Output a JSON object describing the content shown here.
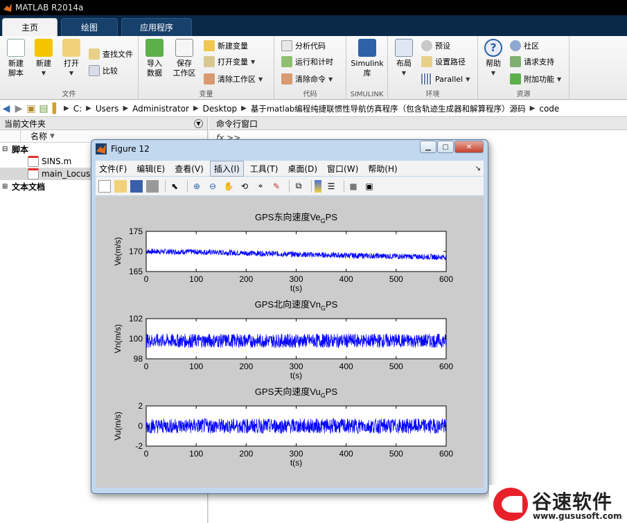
{
  "window": {
    "title": "MATLAB R2014a"
  },
  "tabs": [
    {
      "label": "主页",
      "active": true
    },
    {
      "label": "绘图",
      "active": false
    },
    {
      "label": "应用程序",
      "active": false
    }
  ],
  "ribbon": {
    "groups": {
      "file": "文件",
      "variable": "变量",
      "code": "代码",
      "simulink": "SIMULINK",
      "environment": "环境",
      "resources": "资源"
    },
    "new_script": "新建\n脚本",
    "new": "新建",
    "open": "打开",
    "find_files": "查找文件",
    "compare": "比较",
    "import_data": "导入\n数据",
    "save_workspace": "保存\n工作区",
    "new_variable": "新建变量",
    "open_variable": "打开变量",
    "clear_workspace": "清除工作区",
    "analyze_code": "分析代码",
    "run_and_time": "运行和计时",
    "clear_commands": "清除命令",
    "simulink_library": "Simulink\n库",
    "layout": "布局",
    "preferences": "预设",
    "set_path": "设置路径",
    "parallel": "Parallel",
    "help": "帮助",
    "community": "社区",
    "request_support": "请求支持",
    "addons": "附加功能"
  },
  "address": {
    "path": [
      "C:",
      "Users",
      "Administrator",
      "Desktop",
      "基于matlab编程纯捷联惯性导航仿真程序（包含轨迹生成器和解算程序）源码",
      "code"
    ]
  },
  "current_folder": {
    "title": "当前文件夹",
    "column_name": "名称",
    "items": [
      {
        "label": "脚本",
        "type": "group"
      },
      {
        "label": "SINS.m",
        "type": "file"
      },
      {
        "label": "main_Locus.m",
        "type": "file"
      },
      {
        "label": "文本文档",
        "type": "group"
      }
    ]
  },
  "command_window": {
    "title": "命令行窗口",
    "prompt": "fx >>"
  },
  "figure": {
    "title": "Figure 12",
    "menu": [
      "文件(F)",
      "编辑(E)",
      "查看(V)",
      "插入(I)",
      "工具(T)",
      "桌面(D)",
      "窗口(W)",
      "帮助(H)"
    ],
    "active_menu": "插入(I)"
  },
  "chart_data": [
    {
      "type": "line",
      "title": "GPS东向速度Ve_GPS",
      "title_main": "GPS东向速度Ve",
      "title_sub": "G",
      "title_tail": "PS",
      "xlabel": "t(s)",
      "ylabel": "Ve(m/s)",
      "xlim": [
        0,
        600
      ],
      "ylim": [
        165,
        175
      ],
      "xticks": [
        0,
        100,
        200,
        300,
        400,
        500,
        600
      ],
      "yticks": [
        165,
        170,
        175
      ],
      "series": [
        {
          "color": "#0000ff",
          "x": [
            0,
            100,
            200,
            300,
            400,
            500,
            600
          ],
          "values": [
            170.0,
            169.9,
            169.6,
            169.3,
            169.0,
            168.8,
            168.6
          ],
          "noise": 0.7
        }
      ]
    },
    {
      "type": "line",
      "title": "GPS北向速度Vn_GPS",
      "title_main": "GPS北向速度Vn",
      "title_sub": "G",
      "title_tail": "PS",
      "xlabel": "t(s)",
      "ylabel": "Vn(m/s)",
      "xlim": [
        0,
        600
      ],
      "ylim": [
        98,
        102
      ],
      "xticks": [
        0,
        100,
        200,
        300,
        400,
        500,
        600
      ],
      "yticks": [
        98,
        100,
        102
      ],
      "series": [
        {
          "color": "#0000ff",
          "x": [
            0,
            100,
            200,
            300,
            400,
            500,
            600
          ],
          "values": [
            99.8,
            99.8,
            99.8,
            99.8,
            99.8,
            99.8,
            99.8
          ],
          "noise": 0.7
        }
      ]
    },
    {
      "type": "line",
      "title": "GPS天向速度Vu_GPS",
      "title_main": "GPS天向速度Vu",
      "title_sub": "G",
      "title_tail": "PS",
      "xlabel": "t(s)",
      "ylabel": "Vu(m/s)",
      "xlim": [
        0,
        600
      ],
      "ylim": [
        -2,
        2
      ],
      "xticks": [
        0,
        100,
        200,
        300,
        400,
        500,
        600
      ],
      "yticks": [
        -2,
        0,
        2
      ],
      "series": [
        {
          "color": "#0000ff",
          "x": [
            0,
            100,
            200,
            300,
            400,
            500,
            600
          ],
          "values": [
            0,
            0,
            0,
            0,
            0,
            0,
            0
          ],
          "noise": 0.75
        }
      ]
    }
  ],
  "watermark": {
    "name": "谷速软件",
    "url": "www.gususoft.com"
  },
  "colors": {
    "ribbon_dark": "#0a2847",
    "plot_line": "#0000ff",
    "figure_bg": "#cccccc"
  }
}
